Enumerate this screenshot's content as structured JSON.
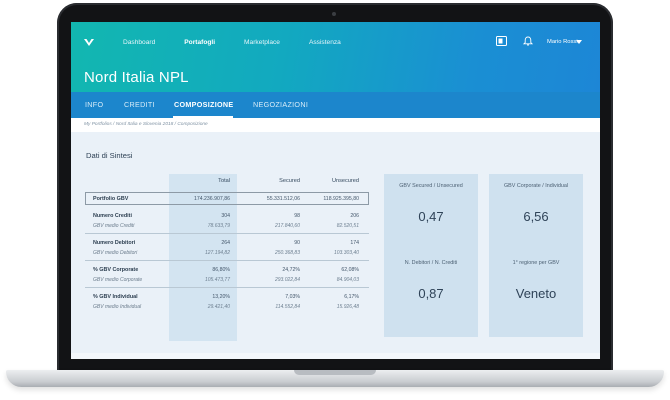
{
  "header": {
    "nav": [
      "Dashboard",
      "Portafogli",
      "Marketplace",
      "Assistenza"
    ],
    "active_nav": "Portafogli",
    "user_name": "Mario Rossi",
    "icons": [
      "logo-icon",
      "document-icon",
      "bell-icon",
      "chevron-down-icon"
    ]
  },
  "page": {
    "title": "Nord Italia NPL",
    "tabs": [
      "INFO",
      "CREDITI",
      "COMPOSIZIONE",
      "NEGOZIAZIONI"
    ],
    "active_tab": "COMPOSIZIONE",
    "breadcrumb": "My Portfolios / Nord Italia e Slovenia 2018 / Composizione"
  },
  "summary": {
    "title": "Dati di Sintesi",
    "columns": [
      "Total",
      "Secured",
      "Unsecured"
    ],
    "rows": [
      {
        "label": "Portfolio GBV",
        "values": [
          "174.236.907,86",
          "55.331.512,06",
          "118.925.395,80"
        ]
      },
      {
        "label": "Numero Crediti",
        "values": [
          "304",
          "98",
          "206"
        ]
      },
      {
        "label": "GBV medio Crediti",
        "values": [
          "78.633,79",
          "217.840,60",
          "82.520,51"
        ]
      },
      {
        "label": "Numero Debitori",
        "values": [
          "264",
          "90",
          "174"
        ]
      },
      {
        "label": "GBV medio Debitori",
        "values": [
          "127.194,82",
          "250.368,83",
          "103.303,40"
        ]
      },
      {
        "label": "% GBV Corporate",
        "values": [
          "86,80%",
          "24,72%",
          "62,08%"
        ]
      },
      {
        "label": "GBV medio Corporate",
        "values": [
          "105.473,77",
          "293.022,84",
          "84.904,03"
        ]
      },
      {
        "label": "% GBV Individual",
        "values": [
          "13,20%",
          "7,03%",
          "6,17%"
        ]
      },
      {
        "label": "GBV medio Individual",
        "values": [
          "29.421,40",
          "114.552,84",
          "15.926,48"
        ]
      }
    ]
  },
  "kpis": [
    {
      "label": "GBV Secured / Unsecured",
      "value": "0,47"
    },
    {
      "label": "GBV Corporate / Individual",
      "value": "6,56"
    },
    {
      "label": "N. Debitori / N. Crediti",
      "value": "0,87"
    },
    {
      "label": "1° regione per GBV",
      "value": "Veneto"
    }
  ]
}
